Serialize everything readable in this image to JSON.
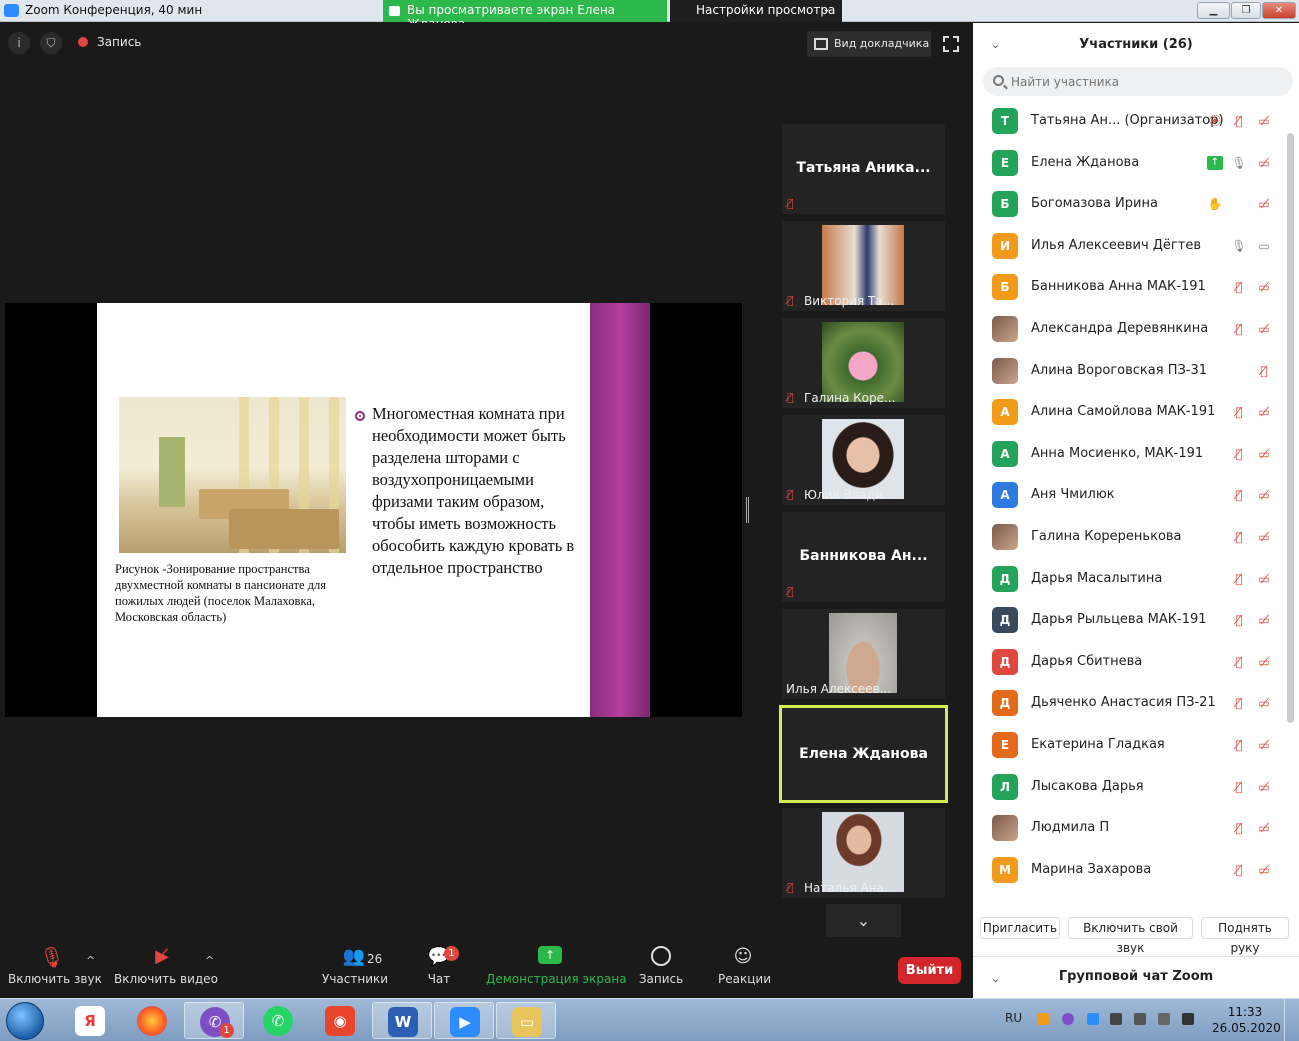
{
  "window": {
    "title": "Zoom Конференция, 40 мин",
    "share_banner": "Вы просматриваете экран Елена Жданова",
    "view_options": "Настройки просмотра"
  },
  "stage": {
    "record_label": "Запись",
    "speaker_view_label": "Вид докладчика"
  },
  "slide": {
    "caption": "Рисунок -Зонирование пространства двухместной комнаты в пансионате для пожилых людей (поселок Малаховка, Московская область)",
    "bullet_text": "Многоместная комната при необходимости может быть разделена шторами с воздухопроницаемыми фризами таким образом, чтобы иметь возможность обособить каждую кровать в отдельное пространство"
  },
  "thumbnails": [
    {
      "name": "Татьяна Аника...",
      "type": "name",
      "muted": true
    },
    {
      "name": "Виктория Та...",
      "type": "photo",
      "muted": true
    },
    {
      "name": "Галина Коре...",
      "type": "photo",
      "muted": true
    },
    {
      "name": "Юлия Влади...",
      "type": "photo",
      "muted": true
    },
    {
      "name": "Банникова Ан...",
      "type": "name",
      "muted": true
    },
    {
      "name": "Илья Алексеев...",
      "type": "photo",
      "muted": false
    },
    {
      "name": "Елена Жданова",
      "type": "name",
      "muted": false,
      "active": true
    },
    {
      "name": "Наталья Ана...",
      "type": "photo",
      "muted": true
    }
  ],
  "toolbar": {
    "unmute": "Включить звук",
    "video": "Включить видео",
    "participants": "Участники",
    "participants_count": "26",
    "chat": "Чат",
    "chat_badge": "1",
    "share": "Демонстрация экрана",
    "record": "Запись",
    "reactions": "Реакции",
    "leave": "Выйти"
  },
  "panel": {
    "title": "Участники (26)",
    "search_placeholder": "Найти участника",
    "participants": [
      {
        "initial": "Т",
        "name": "Татьяна Ан...   (Организатор)",
        "color": "#23a45a",
        "mic": "muted",
        "cam": "off",
        "extra": "record"
      },
      {
        "initial": "Е",
        "name": "Елена Жданова",
        "color": "#23a45a",
        "mic": "on",
        "cam": "off",
        "extra": "share"
      },
      {
        "initial": "Б",
        "name": "Богомазова Ирина",
        "color": "#23a45a",
        "mic": "none",
        "cam": "off",
        "extra": "hand"
      },
      {
        "initial": "И",
        "name": "Илья Алексеевич Дёгтев",
        "color": "#f29a1a",
        "mic": "on",
        "cam": "on",
        "extra": ""
      },
      {
        "initial": "Б",
        "name": " Банникова Анна МАК-191",
        "color": "#f29a1a",
        "mic": "muted",
        "cam": "off",
        "extra": ""
      },
      {
        "initial": "",
        "name": "Александра Деревянкина",
        "color": "photo",
        "mic": "muted",
        "cam": "off",
        "extra": ""
      },
      {
        "initial": "",
        "name": "Алина Вороговская ПЗ-31",
        "color": "photo",
        "mic": "none",
        "cam": "muted-only",
        "extra": ""
      },
      {
        "initial": "А",
        "name": "Алина Самойлова МАК-191",
        "color": "#f29a1a",
        "mic": "muted",
        "cam": "off",
        "extra": ""
      },
      {
        "initial": "А",
        "name": "Анна Мосиенко, МАК-191",
        "color": "#23a45a",
        "mic": "muted",
        "cam": "off",
        "extra": ""
      },
      {
        "initial": "А",
        "name": "Аня Чмилюк",
        "color": "#2d7be0",
        "mic": "muted",
        "cam": "off",
        "extra": ""
      },
      {
        "initial": "",
        "name": "Галина Кореренькова",
        "color": "photo",
        "mic": "muted",
        "cam": "off",
        "extra": ""
      },
      {
        "initial": "Д",
        "name": "Дарья Масалытина",
        "color": "#23a45a",
        "mic": "muted",
        "cam": "off",
        "extra": ""
      },
      {
        "initial": "Д",
        "name": "Дарья Рыльцева МАК-191",
        "color": "#3a4a5e",
        "mic": "muted",
        "cam": "off",
        "extra": ""
      },
      {
        "initial": "Д",
        "name": "Дарья Сбитнева",
        "color": "#e0483f",
        "mic": "muted",
        "cam": "off",
        "extra": ""
      },
      {
        "initial": "Д",
        "name": "Дьяченко Анастасия ПЗ-21",
        "color": "#e36a1b",
        "mic": "muted",
        "cam": "off",
        "extra": ""
      },
      {
        "initial": "Е",
        "name": "Екатерина Гладкая",
        "color": "#e36a1b",
        "mic": "muted",
        "cam": "off",
        "extra": ""
      },
      {
        "initial": "Л",
        "name": "Лысакова Дарья",
        "color": "#23a45a",
        "mic": "muted",
        "cam": "off",
        "extra": ""
      },
      {
        "initial": "",
        "name": "Людмила П",
        "color": "photo",
        "mic": "muted",
        "cam": "off",
        "extra": ""
      },
      {
        "initial": "М",
        "name": "Марина Захарова",
        "color": "#f29a1a",
        "mic": "muted",
        "cam": "off",
        "extra": ""
      }
    ],
    "invite": "Пригласить",
    "unmute_me": "Включить свой звук",
    "raise_hand": "Поднять руку",
    "chat_title": "Групповой чат Zoom"
  },
  "taskbar": {
    "lang": "RU",
    "time": "11:33",
    "date": "26.05.2020",
    "viber_badge": "1"
  },
  "colors": {
    "zoom_blue": "#2d8cff",
    "share_green": "#2db84b",
    "mute_red": "#e0483f",
    "active_border": "#d6ec4e",
    "leave_red": "#d3262b"
  }
}
